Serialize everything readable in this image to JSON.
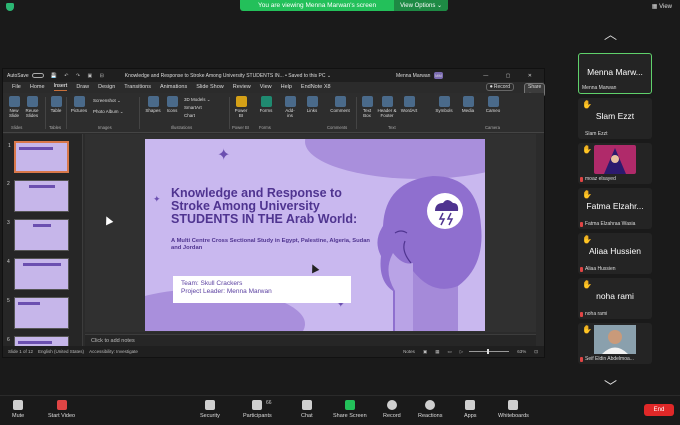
{
  "zoom": {
    "banner": "You are viewing Menna Marwan's screen",
    "view_options": "View Options ⌄",
    "view_button": "View"
  },
  "ppt": {
    "autosave_label": "AutoSave",
    "toggle_state": "Off",
    "doc_title": "Knowledge and Response to Stroke Among University STUDENTS IN... • Saved to this PC ⌄",
    "user_name": "Menna Marwan",
    "user_initials": "MM",
    "tabs": [
      "File",
      "Home",
      "Insert",
      "Draw",
      "Design",
      "Transitions",
      "Animations",
      "Slide Show",
      "Review",
      "View",
      "Help",
      "EndNote X8"
    ],
    "active_tab": "Insert",
    "record_label": "⏺ Record",
    "share_label": "Share ⌄",
    "ribbon": {
      "new_slide": "New Slide",
      "reuse_slides": "Reuse Slides",
      "table": "Table",
      "pictures": "Pictures",
      "screenshot": "Screenshot ⌄",
      "photo_album": "Photo Album ⌄",
      "shapes": "Shapes",
      "icons": "Icons",
      "models_3d": "3D Models ⌄",
      "smartart": "SmartArt",
      "chart": "Chart",
      "power_bi": "Power BI",
      "forms": "Forms",
      "addins": "Add-ins",
      "links": "Links",
      "comment": "Comment",
      "text_box": "Text Box",
      "header_footer": "Header & Footer",
      "wordart": "WordArt",
      "symbols": "Symbols",
      "media": "Media",
      "cameo": "Cameo",
      "groups": [
        "Slides",
        "Tables",
        "Images",
        "Illustrations",
        "Power BI",
        "Forms",
        "Comments",
        "Text",
        "Camera"
      ]
    },
    "slide_numbers": [
      "1",
      "2",
      "3",
      "4",
      "5",
      "6"
    ],
    "slide": {
      "title": "Knowledge and Response to Stroke Among University STUDENTS IN THE Arab World:",
      "subtitle": "A Multi Centre Cross Sectional Study in Egypt, Palestine, Algeria, Sudan and Jordan",
      "team": "Team: Skull Crackers",
      "leader": "Project Leader: Menna Marwan"
    },
    "thumb_titles": [
      "Team Members",
      "Timeline",
      "Research Gap and Problems",
      "Study Protocol",
      "Questionnaire"
    ],
    "notes_placeholder": "Click to add notes",
    "status": {
      "slide_of": "Slide 1 of 12",
      "language": "English (United States)",
      "accessibility": "Accessibility: Investigate",
      "notes": "Notes",
      "zoom": "63%"
    }
  },
  "participants": [
    {
      "name": "Menna Marw...",
      "label": "Menna Marwan",
      "type": "text",
      "muted": false,
      "active": true
    },
    {
      "name": "Slam Ezzt",
      "label": "Slam Ezzt",
      "type": "text",
      "muted": false,
      "active": false
    },
    {
      "name": "",
      "label": "moaz elsayed",
      "type": "avatar",
      "muted": true,
      "active": false,
      "color": "#b02a6a"
    },
    {
      "name": "Fatma Elzahr...",
      "label": "Fatma Elzahraa Wasia",
      "type": "text",
      "muted": true,
      "active": false
    },
    {
      "name": "Aliaa Hussien",
      "label": "Aliaa Hussien",
      "type": "text",
      "muted": true,
      "active": false
    },
    {
      "name": "noha rami",
      "label": "noha rami",
      "type": "text",
      "muted": true,
      "active": false
    },
    {
      "name": "",
      "label": "Seif Eldin Abdelmoa...",
      "type": "video",
      "muted": true,
      "active": false,
      "color": "#6a8090"
    }
  ],
  "toolbar": {
    "mute": "Mute",
    "start_video": "Start Video",
    "security": "Security",
    "participants": "Participants",
    "participant_count": "66",
    "chat": "Chat",
    "share_screen": "Share Screen",
    "record": "Record",
    "reactions": "Reactions",
    "apps": "Apps",
    "whiteboards": "Whiteboards",
    "end": "End"
  },
  "colors": {
    "accent_green": "#23c05a",
    "slide_bg": "#c9b8ef",
    "slide_title": "#4f3490",
    "end_red": "#e02828"
  }
}
